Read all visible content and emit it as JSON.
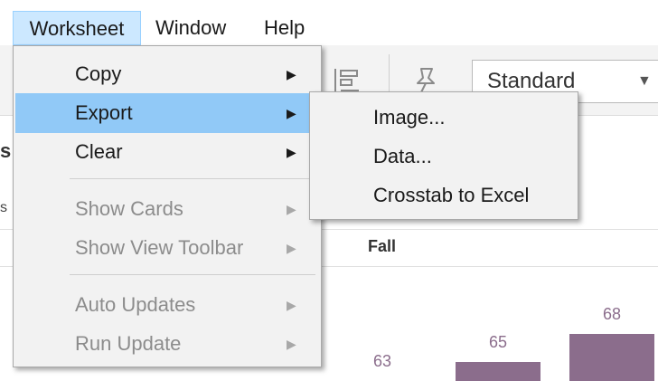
{
  "menubar": {
    "items": [
      {
        "label": "Worksheet"
      },
      {
        "label": "Window"
      },
      {
        "label": "Help"
      }
    ]
  },
  "toolbar": {
    "view_select": "Standard",
    "icons": [
      "sort-icon",
      "pin-icon",
      "chevron-down-icon"
    ]
  },
  "sheet": {
    "column_header": "Fall"
  },
  "chart_data": {
    "type": "bar",
    "values": [
      63,
      65,
      68
    ],
    "color": "#8b6d8c"
  },
  "worksheet_menu": {
    "items": [
      {
        "label": "Copy",
        "enabled": true,
        "submenu": true
      },
      {
        "label": "Export",
        "enabled": true,
        "submenu": true,
        "highlighted": true
      },
      {
        "label": "Clear",
        "enabled": true,
        "submenu": true
      },
      {
        "label": "Show Cards",
        "enabled": false,
        "submenu": true
      },
      {
        "label": "Show View Toolbar",
        "enabled": false,
        "submenu": true
      },
      {
        "label": "Auto Updates",
        "enabled": false,
        "submenu": true
      },
      {
        "label": "Run Update",
        "enabled": false,
        "submenu": true
      }
    ],
    "arrow_glyph": "▶"
  },
  "export_submenu": {
    "items": [
      {
        "label": "Image..."
      },
      {
        "label": "Data..."
      },
      {
        "label": "Crosstab to Excel"
      }
    ]
  },
  "colors": {
    "menu_bg": "#f2f2f2",
    "highlight": "#91c9f7",
    "active_menubar": "#cce8ff",
    "disabled_text": "#8c8c8c",
    "bar": "#8b6d8c"
  }
}
